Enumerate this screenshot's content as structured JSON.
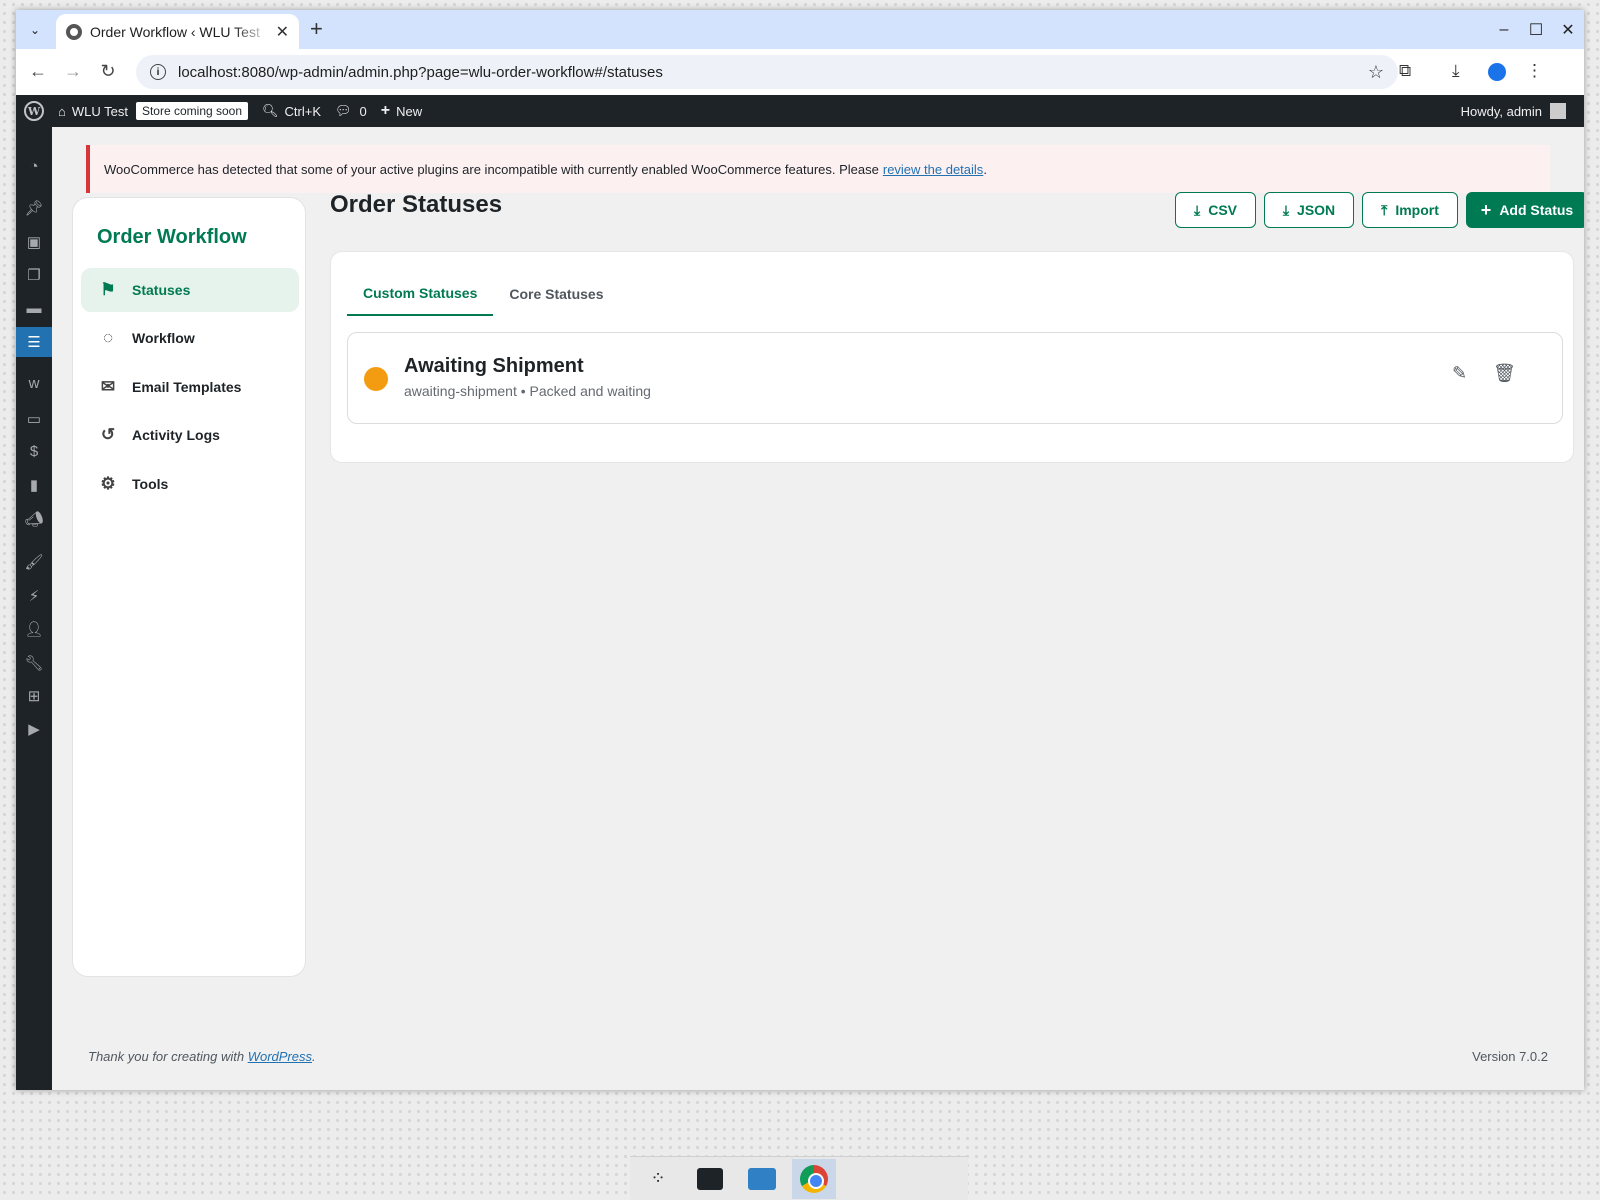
{
  "browser": {
    "tab_title": "Order Workflow ‹ WLU Test",
    "url": "localhost:8080/wp-admin/admin.php?page=wlu-order-workflow#/statuses"
  },
  "adminbar": {
    "site_name": "WLU Test",
    "store_badge": "Store coming soon",
    "search_shortcut": "Ctrl+K",
    "comments_count": "0",
    "new_label": "New",
    "howdy": "Howdy, admin"
  },
  "notice": {
    "text": "WooCommerce has detected that some of your active plugins are incompatible with currently enabled WooCommerce features. Please",
    "link_text": "review the details",
    "suffix": "."
  },
  "sidebar": {
    "title": "Order Workflow",
    "items": [
      {
        "label": "Statuses",
        "icon": "flag-icon",
        "active": true
      },
      {
        "label": "Workflow",
        "icon": "workflow-icon",
        "active": false
      },
      {
        "label": "Email Templates",
        "icon": "envelope-icon",
        "active": false
      },
      {
        "label": "Activity Logs",
        "icon": "history-icon",
        "active": false
      },
      {
        "label": "Tools",
        "icon": "gear-icon",
        "active": false
      }
    ]
  },
  "page": {
    "title": "Order Statuses",
    "buttons": {
      "csv": "CSV",
      "json": "JSON",
      "import": "Import",
      "add": "Add Status"
    },
    "tabs": [
      {
        "label": "Custom Statuses",
        "active": true
      },
      {
        "label": "Core Statuses",
        "active": false
      }
    ],
    "statuses": [
      {
        "name": "Awaiting Shipment",
        "meta": "awaiting-shipment • Packed and waiting",
        "color": "#f39c12"
      }
    ]
  },
  "footer": {
    "thanks_prefix": "Thank you for creating with",
    "thanks_link": "WordPress",
    "thanks_suffix": ".",
    "version": "Version 7.0.2"
  },
  "colors": {
    "accent": "#007a52",
    "notice_border": "#d63638",
    "wp_active": "#2271b1"
  }
}
